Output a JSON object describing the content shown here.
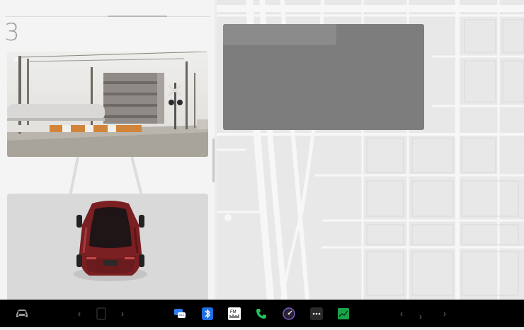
{
  "left_panel": {
    "speed_value": "3",
    "camera": {
      "close_label": "×"
    }
  },
  "taskbar": {
    "icons": [
      "car-icon",
      "chevron-left-icon",
      "climate-icon",
      "chevron-right-icon",
      "messages-icon",
      "bluetooth-icon",
      "radio-icon",
      "phone-icon",
      "camera-app-icon",
      "more-icon",
      "energy-icon",
      "volume-left-icon",
      "volume-right-icon"
    ],
    "radio_label": "FM"
  },
  "colors": {
    "map_background": "#e8e8e8",
    "overlay": "#7d7d7d",
    "car_body": "#7a1f22",
    "taskbar": "#000000",
    "messages_blue": "#2e7cf6",
    "bluetooth_blue": "#1f6fe0",
    "phone_green": "#22c35a",
    "energy_green": "#1aa34a"
  }
}
